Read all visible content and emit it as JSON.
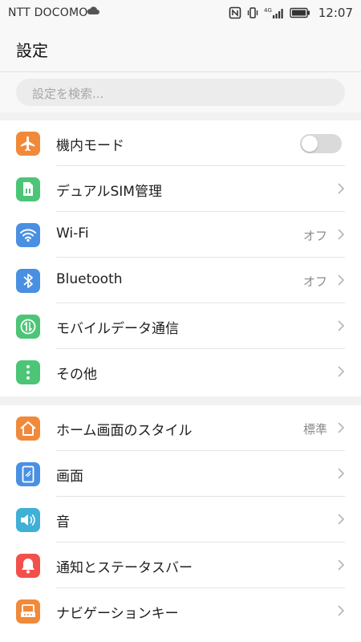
{
  "status_bar": {
    "carrier": "NTT DOCOMO",
    "network": "4G",
    "time": "12:07"
  },
  "header": {
    "title": "設定"
  },
  "search": {
    "placeholder": "設定を検索..."
  },
  "section1": [
    {
      "label": "機内モード",
      "icon": "airplane-icon",
      "color": "#f08a3a",
      "toggle": "off"
    },
    {
      "label": "デュアルSIM管理",
      "icon": "sim-card-icon",
      "color": "#4cc576"
    },
    {
      "label": "Wi-Fi",
      "icon": "wifi-icon",
      "color": "#4a90e2",
      "value": "オフ"
    },
    {
      "label": "Bluetooth",
      "icon": "bluetooth-icon",
      "color": "#4a90e2",
      "value": "オフ"
    },
    {
      "label": "モバイルデータ通信",
      "icon": "mobile-data-icon",
      "color": "#4cc576"
    },
    {
      "label": "その他",
      "icon": "more-icon",
      "color": "#4cc576"
    }
  ],
  "section2": [
    {
      "label": "ホーム画面のスタイル",
      "icon": "home-icon",
      "color": "#f08a3a",
      "value": "標準"
    },
    {
      "label": "画面",
      "icon": "display-icon",
      "color": "#4a90e2"
    },
    {
      "label": "音",
      "icon": "speaker-icon",
      "color": "#3fb0d6"
    },
    {
      "label": "通知とステータスバー",
      "icon": "bell-icon",
      "color": "#f2504b"
    },
    {
      "label": "ナビゲーションキー",
      "icon": "navigation-key-icon",
      "color": "#f08a3a"
    }
  ]
}
